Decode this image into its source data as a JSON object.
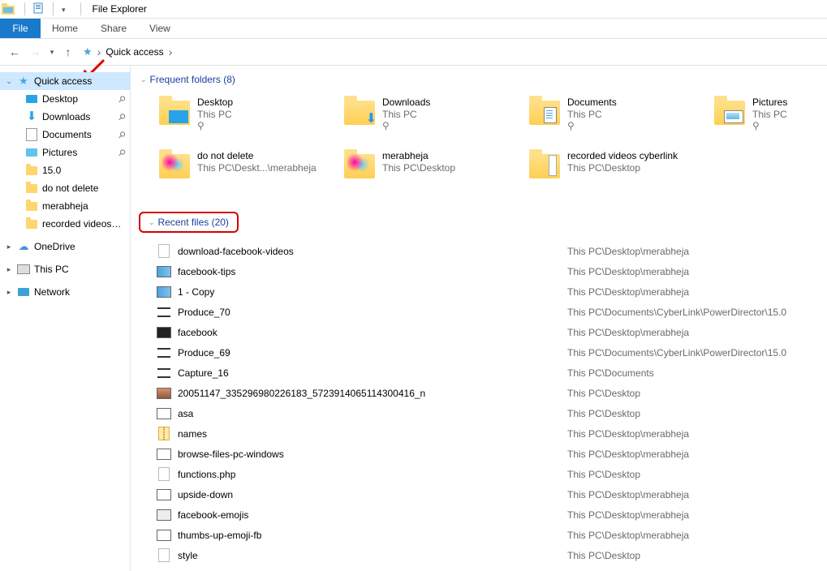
{
  "window": {
    "title": "File Explorer"
  },
  "ribbon": {
    "file": "File",
    "home": "Home",
    "share": "Share",
    "view": "View"
  },
  "address": {
    "root": "Quick access"
  },
  "sidebar": {
    "quick_access": "Quick access",
    "items": [
      {
        "label": "Desktop",
        "icon": "desktop",
        "pinned": true
      },
      {
        "label": "Downloads",
        "icon": "download",
        "pinned": true
      },
      {
        "label": "Documents",
        "icon": "docs",
        "pinned": true
      },
      {
        "label": "Pictures",
        "icon": "pics",
        "pinned": true
      },
      {
        "label": "15.0",
        "icon": "folder",
        "pinned": false
      },
      {
        "label": "do not delete",
        "icon": "folder",
        "pinned": false
      },
      {
        "label": "merabheja",
        "icon": "folder",
        "pinned": false
      },
      {
        "label": "recorded videos cyberlink",
        "icon": "folder",
        "pinned": false
      }
    ],
    "onedrive": "OneDrive",
    "this_pc": "This PC",
    "network": "Network"
  },
  "main": {
    "frequent_header": "Frequent folders (8)",
    "folders": [
      {
        "name": "Desktop",
        "loc": "This PC",
        "pin": true,
        "overlay": "desktop"
      },
      {
        "name": "Downloads",
        "loc": "This PC",
        "pin": true,
        "overlay": "download"
      },
      {
        "name": "Documents",
        "loc": "This PC",
        "pin": true,
        "overlay": "docs"
      },
      {
        "name": "Pictures",
        "loc": "This PC",
        "pin": true,
        "overlay": "pics"
      },
      {
        "name": "do not delete",
        "loc": "This PC\\Deskt...\\merabheja",
        "pin": false,
        "overlay": "people"
      },
      {
        "name": "merabheja",
        "loc": "This PC\\Desktop",
        "pin": false,
        "overlay": "people"
      },
      {
        "name": "recorded videos cyberlink",
        "loc": "This PC\\Desktop",
        "pin": false,
        "overlay": "video"
      },
      {
        "name": "",
        "loc": "",
        "pin": false,
        "overlay": "",
        "hidden": true
      }
    ],
    "recent_header": "Recent files (20)",
    "recent": [
      {
        "name": "download-facebook-videos",
        "loc": "This PC\\Desktop\\merabheja",
        "icon": "file"
      },
      {
        "name": "facebook-tips",
        "loc": "This PC\\Desktop\\merabheja",
        "icon": "thumb-col"
      },
      {
        "name": "1 - Copy",
        "loc": "This PC\\Desktop\\merabheja",
        "icon": "thumb-col"
      },
      {
        "name": "Produce_70",
        "loc": "This PC\\Documents\\CyberLink\\PowerDirector\\15.0",
        "icon": "strip"
      },
      {
        "name": "facebook",
        "loc": "This PC\\Desktop\\merabheja",
        "icon": "thumb-dark"
      },
      {
        "name": "Produce_69",
        "loc": "This PC\\Documents\\CyberLink\\PowerDirector\\15.0",
        "icon": "strip"
      },
      {
        "name": "Capture_16",
        "loc": "This PC\\Documents",
        "icon": "strip"
      },
      {
        "name": "20051147_335296980226183_5723914065114300416_n",
        "loc": "This PC\\Desktop",
        "icon": "thumb-photo"
      },
      {
        "name": "asa",
        "loc": "This PC\\Desktop",
        "icon": "thumb-white"
      },
      {
        "name": "names",
        "loc": "This PC\\Desktop\\merabheja",
        "icon": "zip"
      },
      {
        "name": "browse-files-pc-windows",
        "loc": "This PC\\Desktop\\merabheja",
        "icon": "thumb-white"
      },
      {
        "name": "functions.php",
        "loc": "This PC\\Desktop",
        "icon": "file"
      },
      {
        "name": "upside-down",
        "loc": "This PC\\Desktop\\merabheja",
        "icon": "thumb-white"
      },
      {
        "name": "facebook-emojis",
        "loc": "This PC\\Desktop\\merabheja",
        "icon": "thumb-keys"
      },
      {
        "name": "thumbs-up-emoji-fb",
        "loc": "This PC\\Desktop\\merabheja",
        "icon": "thumb-white"
      },
      {
        "name": "style",
        "loc": "This PC\\Desktop",
        "icon": "file"
      }
    ]
  }
}
